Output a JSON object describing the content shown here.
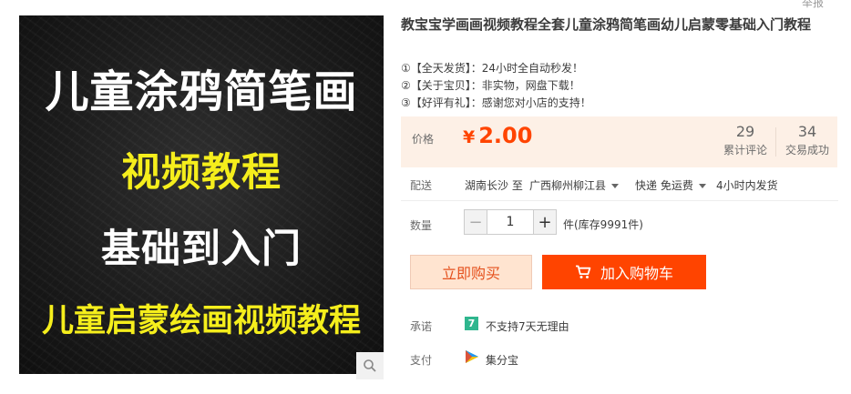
{
  "top_link": "举报",
  "image_texts": {
    "line1": "儿童涂鸦简笔画",
    "line2": "视频教程",
    "line3": "基础到入门",
    "line4": "儿童启蒙绘画视频教程"
  },
  "product": {
    "title": "教宝宝学画画视频教程全套儿童涂鸦简笔画幼儿启蒙零基础入门教程",
    "notes": [
      "①【全天发货】：24小时全自动秒发！",
      "②【关于宝贝】：非实物，网盘下载！",
      "③【好评有礼】：感谢您对小店的支持！"
    ]
  },
  "price": {
    "label": "价格",
    "currency": "¥",
    "amount": "2.00",
    "reviews_count": "29",
    "reviews_label": "累计评论",
    "deals_count": "34",
    "deals_label": "交易成功"
  },
  "shipping": {
    "label": "配送",
    "from": "湖南长沙 至",
    "to": "广西柳州柳江县",
    "method": "快递 免运费",
    "dispatch": "4小时内发货"
  },
  "quantity": {
    "label": "数量",
    "value": "1",
    "minus": "−",
    "plus": "+",
    "stock": "件(库存9991件)"
  },
  "actions": {
    "buy_now": "立即购买",
    "add_to_cart": "加入购物车"
  },
  "promise": {
    "label": "承诺",
    "badge": "7",
    "text": "不支持7天无理由"
  },
  "payment": {
    "label": "支付",
    "text": "集分宝"
  },
  "colors": {
    "accent": "#ff4400",
    "price_bg": "#fdf0e6",
    "buy_bg": "#ffe4d0",
    "image_yellow": "#f5ee1c"
  }
}
